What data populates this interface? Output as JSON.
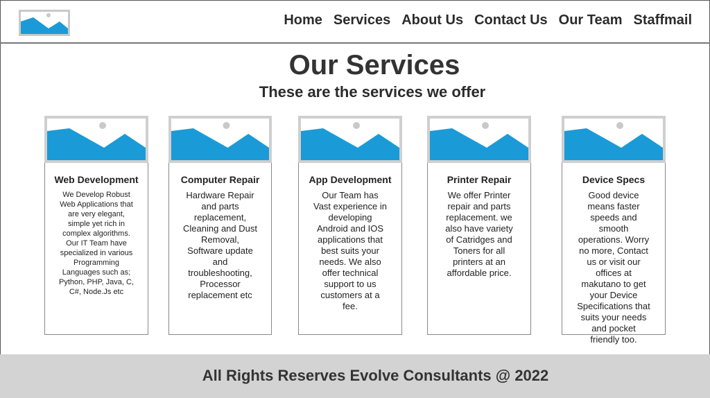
{
  "header": {
    "logo": {
      "icon": "image-placeholder-icon",
      "color": "#1a9bd7"
    },
    "nav": [
      {
        "label": "Home"
      },
      {
        "label": "Services"
      },
      {
        "label": "About Us"
      },
      {
        "label": "Contact Us"
      },
      {
        "label": "Our Team"
      },
      {
        "label": "Staffmail"
      }
    ]
  },
  "main": {
    "title": "Our Services",
    "subtitle": "These are the services we offer",
    "cards": [
      {
        "title": "Web Development",
        "image_icon": "image-placeholder-icon",
        "description": "We Develop Robust Web Applications that are very elegant, simple yet rich in complex algorithms. Our IT Team have specialized in various Programming Languages such as; Python, PHP, Java, C, C#, Node.Js etc"
      },
      {
        "title": "Computer Repair",
        "image_icon": "image-placeholder-icon",
        "description": "Hardware Repair and parts replacement, Cleaning and Dust Removal, Software update and troubleshooting, Processor replacement etc"
      },
      {
        "title": "App Development",
        "image_icon": "image-placeholder-icon",
        "description": "Our Team has Vast experience in developing Android and IOS applications that best suits your needs. We also offer technical support to us customers at a fee."
      },
      {
        "title": "Printer Repair",
        "image_icon": "image-placeholder-icon",
        "description": "We offer Printer repair and parts replacement. we also have variety of Catridges and Toners for all printers at an affordable price."
      },
      {
        "title": "Device Specs",
        "image_icon": "image-placeholder-icon",
        "description": "Good device means faster speeds and smooth operations. Worry no more, Contact us or visit our offices at makutano to get your Device Specifications that suits your needs and pocket friendly too."
      }
    ]
  },
  "footer": {
    "text": "All Rights Reserves Evolve Consultants @ 2022"
  },
  "colors": {
    "accent": "#1a9bd7",
    "placeholder_border": "#cfcfcf",
    "footer_bg": "#d3d3d3"
  }
}
